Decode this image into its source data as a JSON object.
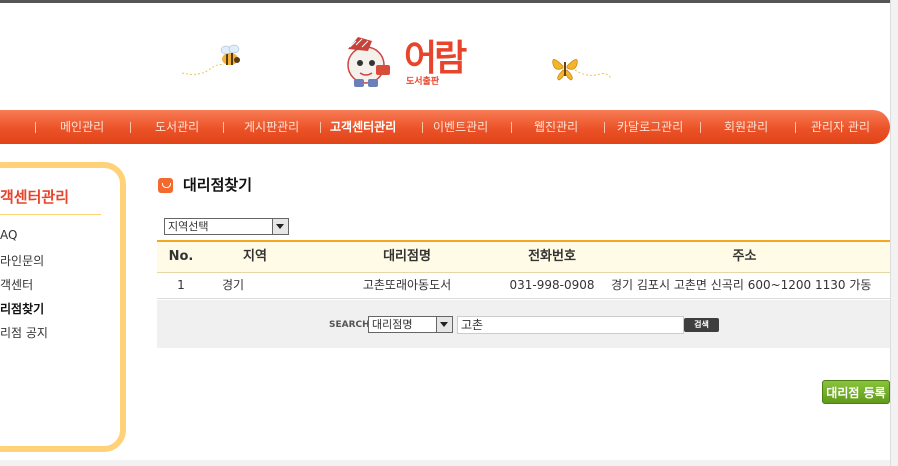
{
  "logo": {
    "main_text": "어람",
    "sub_text": "도서출판"
  },
  "nav": {
    "items": [
      {
        "label": "메인관리",
        "active": false
      },
      {
        "label": "도서관리",
        "active": false
      },
      {
        "label": "게시판관리",
        "active": false
      },
      {
        "label": "고객센터관리",
        "active": true
      },
      {
        "label": "이벤트관리",
        "active": false
      },
      {
        "label": "웹진관리",
        "active": false
      },
      {
        "label": "카달로그관리",
        "active": false
      },
      {
        "label": "회원관리",
        "active": false
      },
      {
        "label": "관리자 관리",
        "active": false
      }
    ]
  },
  "sidebar": {
    "title": "객센터관리",
    "items": [
      {
        "label": "AQ",
        "current": false
      },
      {
        "label": "라인문의",
        "current": false
      },
      {
        "label": "객센터",
        "current": false
      },
      {
        "label": "리점찾기",
        "current": true
      },
      {
        "label": "리점 공지",
        "current": false
      }
    ]
  },
  "main": {
    "title": "대리점찾기",
    "region_select": "지역선택",
    "table": {
      "headers": [
        "No.",
        "지역",
        "대리점명",
        "전화번호",
        "주소"
      ],
      "rows": [
        [
          "1",
          "경기",
          "고촌또래아동도서",
          "031-998-0908",
          "경기 김포시 고촌면 신곡리 600~1200 1130 가동"
        ]
      ]
    },
    "search": {
      "label": "SEARCH",
      "field_select": "대리점명",
      "query": "고촌",
      "button_label": "검색"
    },
    "register_button": "대리점 등록"
  },
  "colors": {
    "accent": "#ec5228",
    "sidebar_border": "#ffd27a",
    "table_header_border": "#f5a623",
    "register_button": "#6fa923"
  }
}
